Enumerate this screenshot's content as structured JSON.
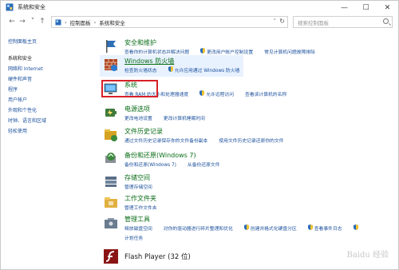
{
  "window": {
    "title": "系统和安全",
    "controls": [
      "—",
      "☐",
      "✕"
    ]
  },
  "nav": {
    "back": "←",
    "forward": "→",
    "down": "˅",
    "up": "↑",
    "crumbs": [
      "控制面板",
      "系统和安全"
    ],
    "search_placeholder": "搜索控制面板"
  },
  "sidebar": {
    "items": [
      {
        "label": "控制面板主页",
        "active": false
      },
      {
        "label": "系统和安全",
        "active": true
      },
      {
        "label": "网络和 Internet",
        "active": false
      },
      {
        "label": "硬件和声音",
        "active": false
      },
      {
        "label": "程序",
        "active": false
      },
      {
        "label": "用户帐户",
        "active": false
      },
      {
        "label": "外观和个性化",
        "active": false
      },
      {
        "label": "时钟、语言和区域",
        "active": false
      },
      {
        "label": "轻松使用",
        "active": false
      }
    ]
  },
  "categories": [
    {
      "heading": "安全和维护",
      "icon": "flag-icon",
      "color": "#2f6fb5",
      "links": [
        "查看你的计算机状态并解决问题",
        "更改用户帐户控制设置",
        "常见计算机问题故障排除"
      ]
    },
    {
      "heading": "Windows 防火墙",
      "icon": "firewall-icon",
      "color": "#b2431f",
      "links": [
        "检查防火墙状态",
        "允许应用通过 Windows 防火墙"
      ]
    },
    {
      "heading": "系统",
      "icon": "system-icon",
      "color": "#2a7fc9",
      "links": [
        "查看 RAM 的大小和处理器速度",
        "允许远程访问",
        "查看该计算机的名称"
      ]
    },
    {
      "heading": "电源选项",
      "icon": "power-icon",
      "color": "#3e7a3a",
      "links": [
        "更改电池设置",
        "更改计算机睡眠时间"
      ]
    },
    {
      "heading": "文件历史记录",
      "icon": "file-history-icon",
      "color": "#d6a221",
      "links": [
        "通过文件历史记录保存你的文件备份副本",
        "使用文件历史记录还原你的文件"
      ]
    },
    {
      "heading": "备份和还原(Windows 7)",
      "icon": "backup-icon",
      "color": "#3a8a3a",
      "links": [
        "备份和还原(Windows 7)",
        "从备份还原文件"
      ]
    },
    {
      "heading": "存储空间",
      "icon": "storage-icon",
      "color": "#5a6e86",
      "links": [
        "管理存储空间"
      ]
    },
    {
      "heading": "工作文件夹",
      "icon": "work-folders-icon",
      "color": "#e0b040",
      "links": [
        "管理工作文件夹"
      ]
    },
    {
      "heading": "管理工具",
      "icon": "admin-tools-icon",
      "color": "#6b7c8f",
      "links": [
        "释放磁盘空间",
        "对你的驱动器进行碎片整理和优化",
        "创建并格式化硬盘分区",
        "查看事件日志",
        "计划任务"
      ]
    },
    {
      "heading": "Flash Player (32 位)",
      "icon": "flash-icon",
      "color": "#8a1414",
      "links": []
    }
  ],
  "watermark": "Baidu 经验"
}
